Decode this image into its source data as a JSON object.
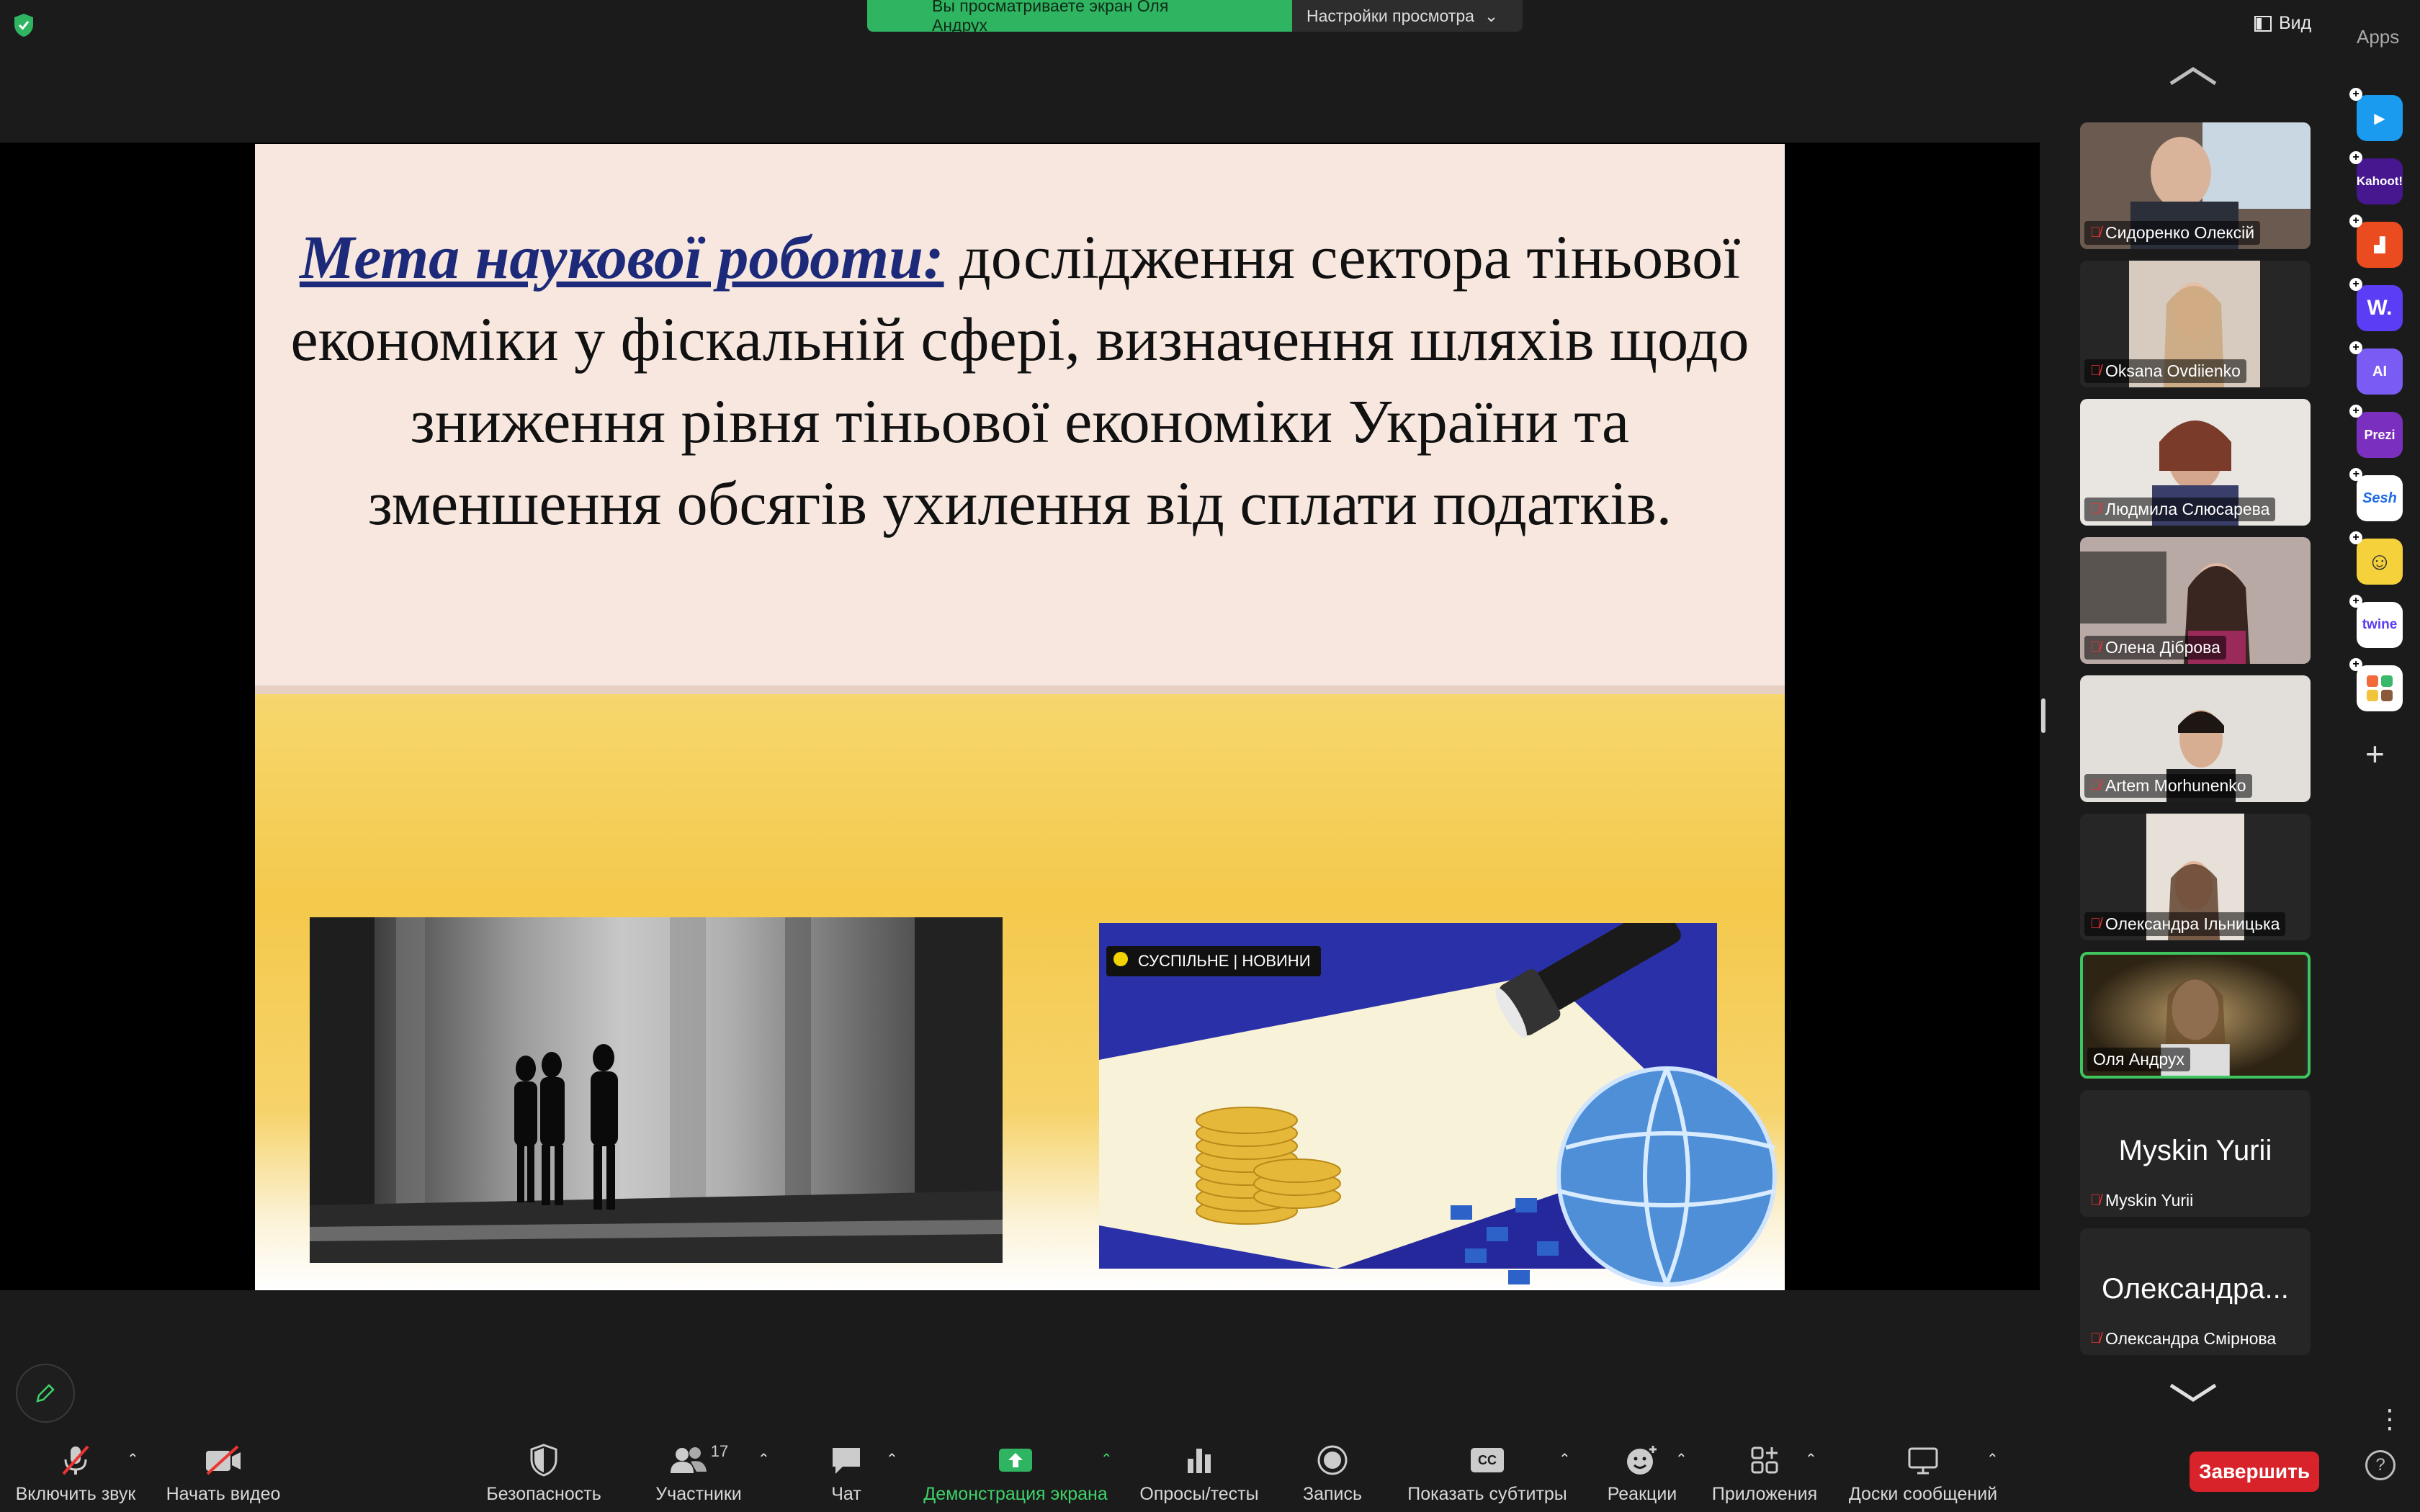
{
  "banner": {
    "viewing_text": "Вы просматриваете экран Оля Андрух",
    "view_options_label": "Настройки просмотра"
  },
  "top_right": {
    "view_label": "Вид",
    "apps_label": "Apps"
  },
  "slide": {
    "title": "Мета наукової роботи:",
    "body": " дослідження сектора тіньової економіки у фіскальній сфері, визначення шляхів щодо зниження рівня тіньової економіки України та зменшення обсягів ухилення від сплати податків.",
    "news_badge": "СУСПІЛЬНЕ | НОВИНИ"
  },
  "participants": [
    {
      "name": "Сидоренко Олексій",
      "muted": true,
      "video": true
    },
    {
      "name": "Oksana Ovdiienko",
      "muted": true,
      "video": true
    },
    {
      "name": "Людмила Слюсарева",
      "muted": true,
      "video": true
    },
    {
      "name": "Олена Діброва",
      "muted": true,
      "video": true
    },
    {
      "name": "Artem Morhunenko",
      "muted": true,
      "video": true
    },
    {
      "name": "Олександра Ільницька",
      "muted": true,
      "video": true
    },
    {
      "name": "Оля Андрух",
      "muted": false,
      "video": true,
      "active": true
    },
    {
      "name": "Myskin Yurii",
      "display": "Myskin Yurii",
      "muted": true,
      "video": false
    },
    {
      "name": "Олександра Смірнова",
      "display": "Олександра...",
      "muted": true,
      "video": false
    }
  ],
  "apps": [
    {
      "name": "app-1",
      "color": "#1a9bf0"
    },
    {
      "name": "kahoot",
      "label": "Kahoot!",
      "color": "#46178f"
    },
    {
      "name": "app-3",
      "color": "#ea4b1f"
    },
    {
      "name": "app-w",
      "label": "W.",
      "color": "#5b3df5"
    },
    {
      "name": "app-ai",
      "label": "AI",
      "color": "#7a5cf5"
    },
    {
      "name": "prezi",
      "label": "Prezi",
      "color": "#7b2fbf"
    },
    {
      "name": "sesh",
      "label": "Sesh",
      "color": "#ffffff"
    },
    {
      "name": "app-face",
      "color": "#f5d23c"
    },
    {
      "name": "twine",
      "label": "twine",
      "color": "#ffffff"
    },
    {
      "name": "app-grid",
      "color": "#ffffff"
    }
  ],
  "toolbar": {
    "unmute": "Включить звук",
    "start_video": "Начать видео",
    "security": "Безопасность",
    "participants": "Участники",
    "participants_count": "17",
    "chat": "Чат",
    "share_screen": "Демонстрация экрана",
    "polls": "Опросы/тесты",
    "record": "Запись",
    "captions": "Показать субтитры",
    "captions_icon": "CC",
    "reactions": "Реакции",
    "apps": "Приложения",
    "whiteboards": "Доски сообщений",
    "end": "Завершить"
  },
  "colors": {
    "banner_green": "#2fb561",
    "active_border": "#3ec55d",
    "end_red": "#d8232a",
    "share_green": "#3fd26a"
  }
}
